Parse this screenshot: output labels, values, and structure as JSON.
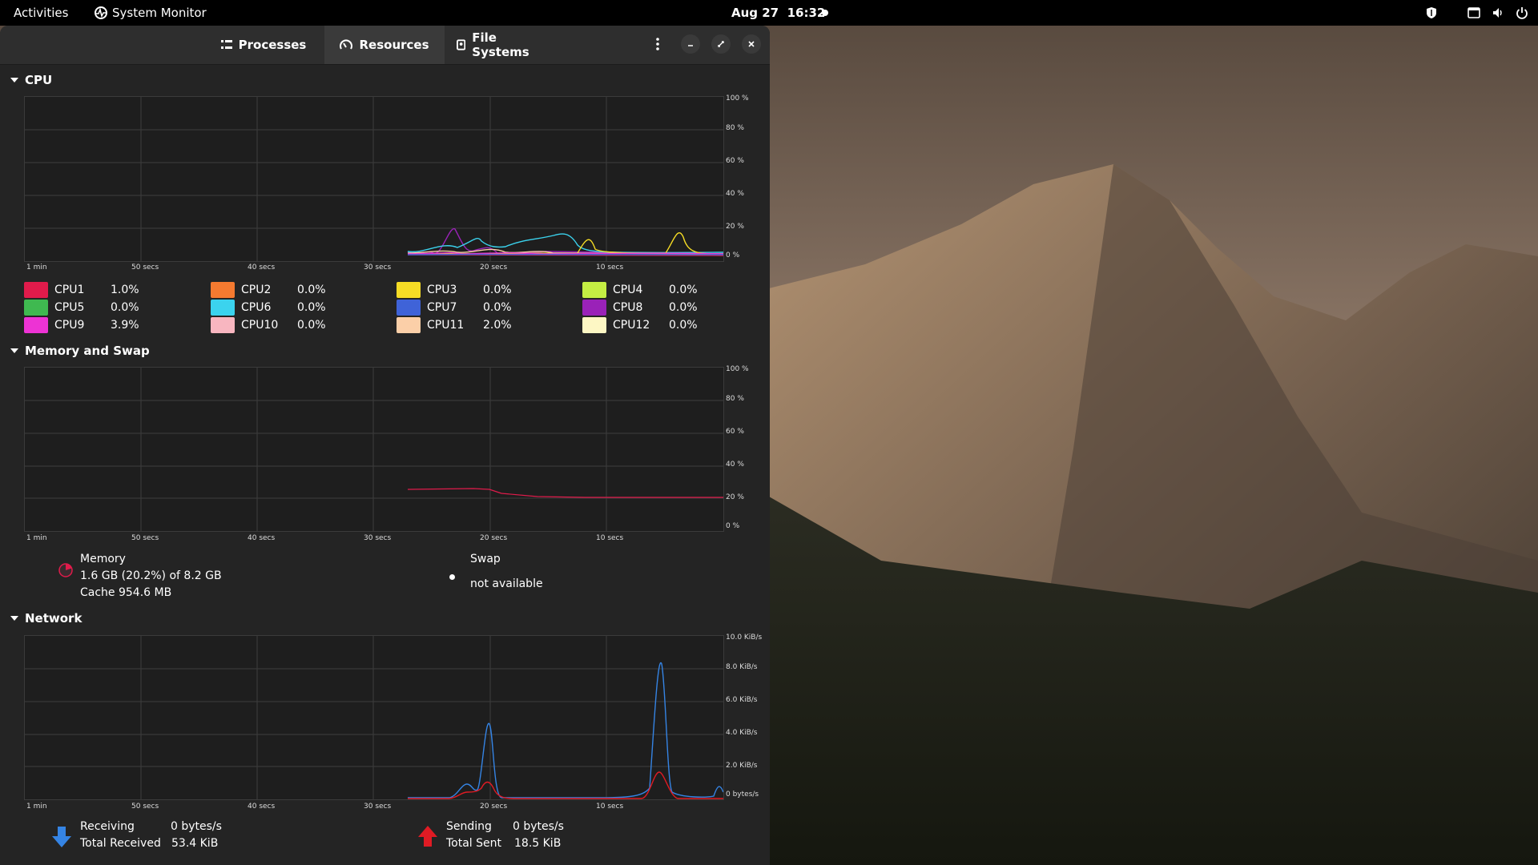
{
  "topbar": {
    "activities": "Activities",
    "app_name": "System Monitor",
    "date": "Aug 27",
    "time": "16:32"
  },
  "tabs": [
    {
      "label": "Processes",
      "icon": "list-icon"
    },
    {
      "label": "Resources",
      "icon": "gauge-icon",
      "active": true
    },
    {
      "label": "File Systems",
      "icon": "disk-icon"
    }
  ],
  "cpu": {
    "title": "CPU",
    "y_ticks": [
      "100 %",
      "80 %",
      "60 %",
      "40 %",
      "20 %",
      "0 %"
    ],
    "x_ticks": [
      "1 min",
      "50 secs",
      "40 secs",
      "30 secs",
      "20 secs",
      "10 secs"
    ],
    "cores": [
      {
        "name": "CPU1",
        "value": "1.0%",
        "color": "#e01b4b"
      },
      {
        "name": "CPU2",
        "value": "0.0%",
        "color": "#f57a30"
      },
      {
        "name": "CPU3",
        "value": "0.0%",
        "color": "#f6dc25"
      },
      {
        "name": "CPU4",
        "value": "0.0%",
        "color": "#c4ee43"
      },
      {
        "name": "CPU5",
        "value": "0.0%",
        "color": "#3fb950"
      },
      {
        "name": "CPU6",
        "value": "0.0%",
        "color": "#3bd3ee"
      },
      {
        "name": "CPU7",
        "value": "0.0%",
        "color": "#3f63d8"
      },
      {
        "name": "CPU8",
        "value": "0.0%",
        "color": "#9a22b8"
      },
      {
        "name": "CPU9",
        "value": "3.9%",
        "color": "#ed33d4"
      },
      {
        "name": "CPU10",
        "value": "0.0%",
        "color": "#f8b6c0"
      },
      {
        "name": "CPU11",
        "value": "2.0%",
        "color": "#fbcfa8"
      },
      {
        "name": "CPU12",
        "value": "0.0%",
        "color": "#fdf7c4"
      }
    ]
  },
  "memory": {
    "title": "Memory and Swap",
    "y_ticks": [
      "100 %",
      "80 %",
      "60 %",
      "40 %",
      "20 %",
      "0 %"
    ],
    "x_ticks": [
      "1 min",
      "50 secs",
      "40 secs",
      "30 secs",
      "20 secs",
      "10 secs"
    ],
    "memory_label": "Memory",
    "memory_usage": "1.6 GB (20.2%) of 8.2 GB",
    "memory_cache": "Cache 954.6 MB",
    "memory_color": "#e01b4b",
    "swap_label": "Swap",
    "swap_status": "not available"
  },
  "network": {
    "title": "Network",
    "y_ticks": [
      "10.0 KiB/s",
      "8.0 KiB/s",
      "6.0 KiB/s",
      "4.0 KiB/s",
      "2.0 KiB/s",
      "0 bytes/s"
    ],
    "x_ticks": [
      "1 min",
      "50 secs",
      "40 secs",
      "30 secs",
      "20 secs",
      "10 secs"
    ],
    "receiving_label": "Receiving",
    "receiving_value": "0 bytes/s",
    "total_received_label": "Total Received",
    "total_received_value": "53.4 KiB",
    "sending_label": "Sending",
    "sending_value": "0 bytes/s",
    "total_sent_label": "Total Sent",
    "total_sent_value": "18.5 KiB",
    "receive_color": "#3584e4",
    "send_color": "#e01b24"
  }
}
